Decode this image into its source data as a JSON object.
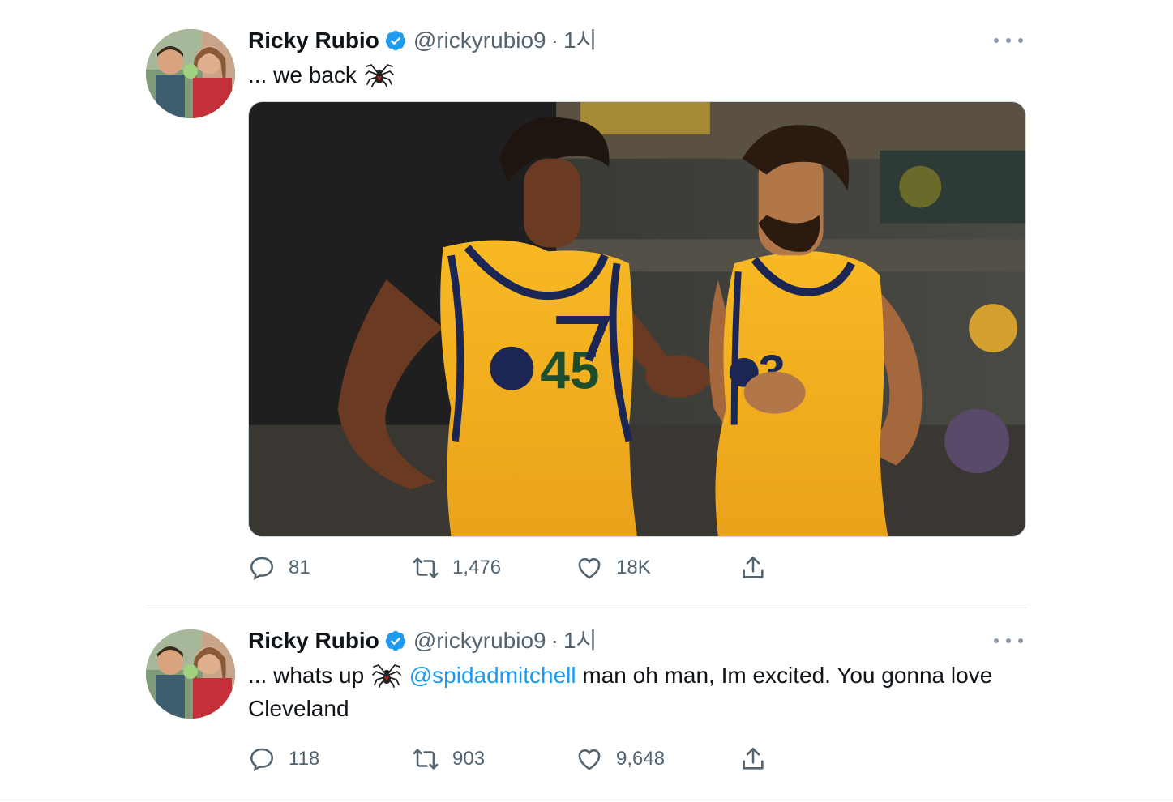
{
  "tweets": [
    {
      "author": {
        "name": "Ricky Rubio",
        "handle": "@rickyrubio9",
        "verified": true
      },
      "time": "1시",
      "separator": "·",
      "text_before": "... we back",
      "emoji": "spider",
      "has_media": true,
      "stats": {
        "replies": "81",
        "retweets": "1,476",
        "likes": "18K"
      }
    },
    {
      "author": {
        "name": "Ricky Rubio",
        "handle": "@rickyrubio9",
        "verified": true
      },
      "time": "1시",
      "separator": "·",
      "text_before": "... whats up",
      "emoji": "spider",
      "mention": "@spidadmitchell",
      "text_after": " man oh man, Im excited. You gonna love Cleveland",
      "has_media": false,
      "stats": {
        "replies": "118",
        "retweets": "903",
        "likes": "9,648"
      }
    }
  ],
  "icons": {
    "verified": "verified-badge-icon",
    "more": "more-options-icon",
    "reply": "reply-icon",
    "retweet": "retweet-icon",
    "like": "heart-icon",
    "share": "share-icon"
  },
  "colors": {
    "accent": "#1d9bf0",
    "text": "#0f1419",
    "muted": "#536471",
    "jersey": "#f7b51c",
    "jersey_trim": "#1b2654"
  }
}
